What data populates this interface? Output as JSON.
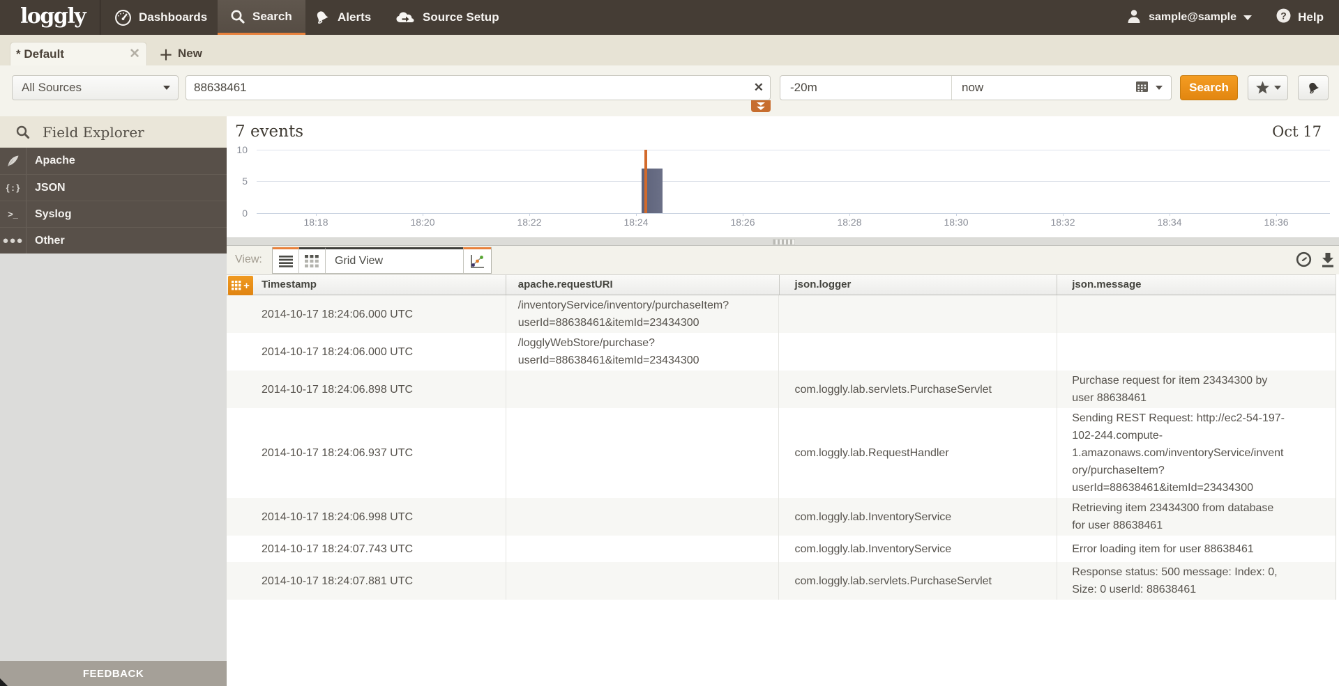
{
  "nav": {
    "logo": "loggly",
    "items": [
      {
        "label": "Dashboards",
        "icon": "dashboard-icon",
        "active": false
      },
      {
        "label": "Search",
        "icon": "search-icon",
        "active": true
      },
      {
        "label": "Alerts",
        "icon": "bell-icon",
        "active": false
      },
      {
        "label": "Source Setup",
        "icon": "cloud-arrow-icon",
        "active": false
      }
    ],
    "user": "sample@sample",
    "help_label": "Help"
  },
  "tabs": {
    "active_label": "* Default",
    "new_label": "New"
  },
  "search": {
    "source_selector_value": "All Sources",
    "query_value": "88638461",
    "time_from_value": "-20m",
    "time_to_value": "now",
    "search_button_label": "Search"
  },
  "sidebar": {
    "title": "Field Explorer",
    "items": [
      {
        "label": "Apache",
        "icon": "feather-icon"
      },
      {
        "label": "JSON",
        "icon": "json-braces-icon"
      },
      {
        "label": "Syslog",
        "icon": "terminal-icon"
      },
      {
        "label": "Other",
        "icon": "ellipsis-icon"
      }
    ],
    "feedback_label": "FEEDBACK"
  },
  "results_header": {
    "count_label": "7 events",
    "date_label": "Oct 17"
  },
  "chart_data": {
    "type": "bar",
    "title": "7 events",
    "date": "Oct 17",
    "ylim": [
      0,
      10
    ],
    "y_ticks": [
      0,
      5,
      10
    ],
    "x_ticks": [
      "18:18",
      "18:20",
      "18:22",
      "18:24",
      "18:26",
      "18:28",
      "18:30",
      "18:32",
      "18:34",
      "18:36"
    ],
    "x_interval_seconds": 120,
    "grid": "horizontal",
    "bars": [
      {
        "time": "18:24:06",
        "value": 7
      }
    ],
    "cursor_time": "18:24:11",
    "bar_color": "#646981",
    "cursor_color": "#d26a2c"
  },
  "viewbar": {
    "view_label": "View:",
    "view_mode_value": "Grid View"
  },
  "table": {
    "columns": [
      "Timestamp",
      "apache.requestURI",
      "json.logger",
      "json.message"
    ],
    "rows": [
      {
        "cells": [
          "2014-10-17 18:24:06.000 UTC",
          "/inventoryService/inventory/purchaseItem?userId=88638461&itemId=23434300",
          "",
          ""
        ]
      },
      {
        "cells": [
          "2014-10-17 18:24:06.000 UTC",
          "/logglyWebStore/purchase?userId=88638461&itemId=23434300",
          "",
          ""
        ]
      },
      {
        "cells": [
          "2014-10-17 18:24:06.898 UTC",
          "",
          "com.loggly.lab.servlets.PurchaseServlet",
          "Purchase request for item 23434300 by user 88638461"
        ]
      },
      {
        "cells": [
          "2014-10-17 18:24:06.937 UTC",
          "",
          "com.loggly.lab.RequestHandler",
          "Sending REST Request: http://ec2-54-197-102-244.compute-1.amazonaws.com/inventoryService/inventory/purchaseItem?userId=88638461&itemId=23434300"
        ]
      },
      {
        "cells": [
          "2014-10-17 18:24:06.998 UTC",
          "",
          "com.loggly.lab.InventoryService",
          "Retrieving item 23434300 from database for user 88638461"
        ]
      },
      {
        "cells": [
          "2014-10-17 18:24:07.743 UTC",
          "",
          "com.loggly.lab.InventoryService",
          "Error loading item for user 88638461"
        ]
      },
      {
        "cells": [
          "2014-10-17 18:24:07.881 UTC",
          "",
          "com.loggly.lab.servlets.PurchaseServlet",
          "Response status: 500 message: Index: 0, Size: 0 userId: 88638461"
        ]
      }
    ]
  },
  "colors": {
    "accent_orange": "#e8813c",
    "button_orange": "#ee9118",
    "navbar_brown": "#453d35",
    "sidebar_item_brown": "#585049",
    "bar_blue_gray": "#646981",
    "cursor_orange": "#d26a2c"
  }
}
